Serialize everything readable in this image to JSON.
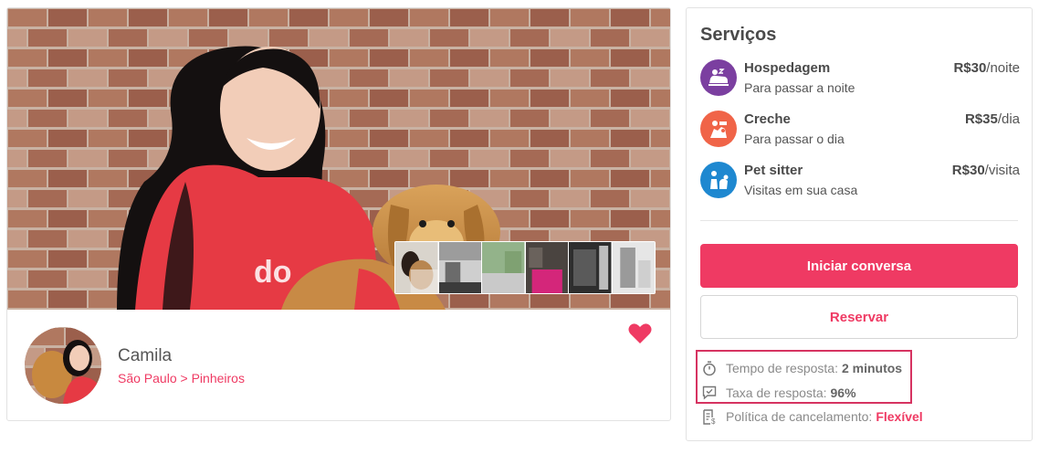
{
  "profile": {
    "name": "Camila",
    "city": "São Paulo",
    "separator": ">",
    "neighborhood": "Pinheiros"
  },
  "services": {
    "title": "Serviços",
    "items": [
      {
        "name": "Hospedagem",
        "desc": "Para passar a noite",
        "price": "R$30",
        "unit": "/noite",
        "icon": "hospedagem-icon",
        "color": "#7b3fa0"
      },
      {
        "name": "Creche",
        "desc": "Para passar o dia",
        "price": "R$35",
        "unit": "/dia",
        "icon": "creche-icon",
        "color": "#f06448"
      },
      {
        "name": "Pet sitter",
        "desc": "Visitas em sua casa",
        "price": "R$30",
        "unit": "/visita",
        "icon": "pet-sitter-icon",
        "color": "#1e88d0"
      }
    ]
  },
  "actions": {
    "start_chat": "Iniciar conversa",
    "book": "Reservar"
  },
  "stats": {
    "response_time_label": "Tempo de resposta:",
    "response_time_value": "2 minutos",
    "response_rate_label": "Taxa de resposta:",
    "response_rate_value": "96%",
    "cancellation_label": "Política de cancelamento:",
    "cancellation_value": "Flexível"
  },
  "colors": {
    "accent": "#ef3a63",
    "highlight": "#d63361"
  }
}
